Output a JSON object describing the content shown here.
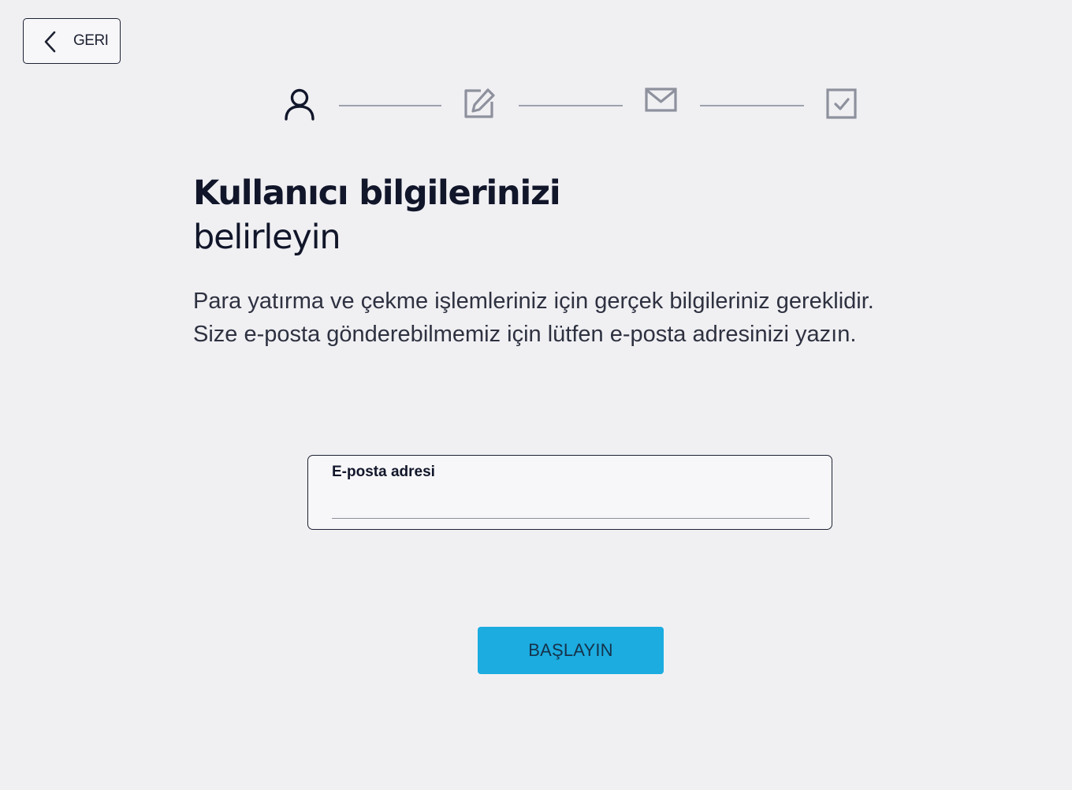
{
  "back_button": {
    "label": "GERI",
    "icon": "chevron-left-icon"
  },
  "stepper": {
    "steps": [
      {
        "icon": "user-icon",
        "state": "active"
      },
      {
        "icon": "edit-icon",
        "state": "pending"
      },
      {
        "icon": "mail-icon",
        "state": "pending"
      },
      {
        "icon": "checkbox-icon",
        "state": "pending"
      }
    ],
    "active_color": "#11162a",
    "pending_color": "#8e919d"
  },
  "heading": {
    "line1": "Kullanıcı bilgilerinizi",
    "line2": "belirleyin"
  },
  "description": "Para yatırma ve çekme işlemleriniz için gerçek bilgileriniz gereklidir. Size e-posta gönderebilmemiz için lütfen e-posta adresinizi yazın.",
  "email_field": {
    "label": "E-posta adresi",
    "value": ""
  },
  "start_button": {
    "label": "BAŞLAYIN",
    "color": "#1cace0"
  }
}
